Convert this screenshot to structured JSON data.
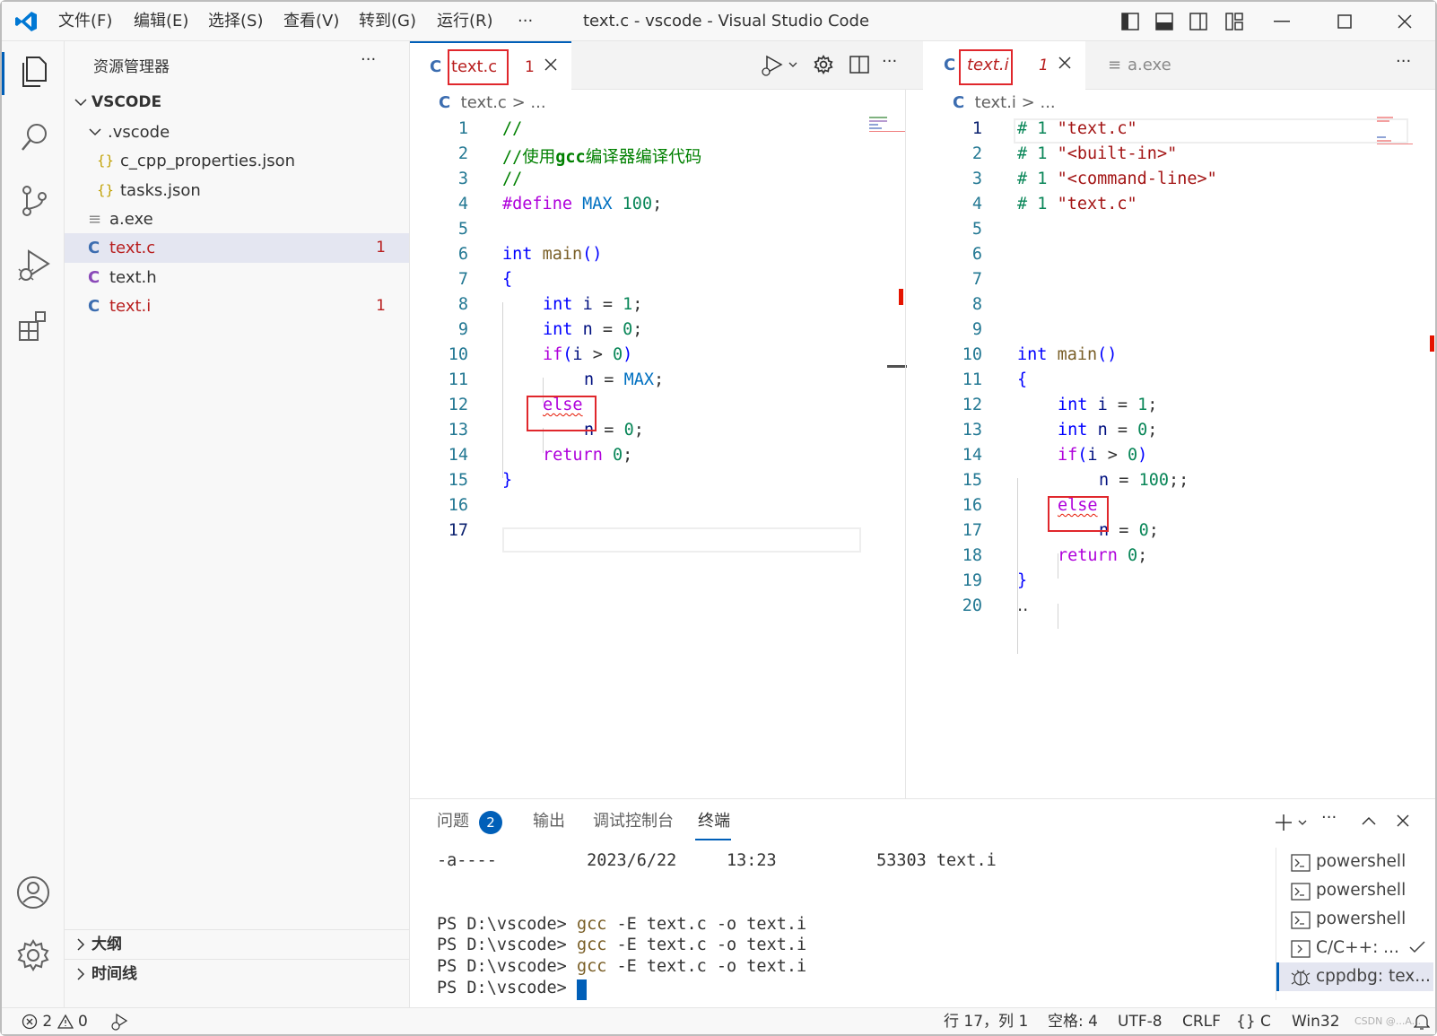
{
  "window": {
    "title": "text.c - vscode - Visual Studio Code"
  },
  "menu": [
    "文件(F)",
    "编辑(E)",
    "选择(S)",
    "查看(V)",
    "转到(G)",
    "运行(R)",
    "···"
  ],
  "sidebar": {
    "title": "资源管理器",
    "more": "···",
    "root": "VSCODE",
    "folder": ".vscode",
    "items": [
      {
        "label": "c_cpp_properties.json",
        "icon": "{}"
      },
      {
        "label": "tasks.json",
        "icon": "{}"
      },
      {
        "label": "a.exe",
        "icon": "≡"
      },
      {
        "label": "text.c",
        "icon": "C",
        "badge": "1"
      },
      {
        "label": "text.h",
        "icon": "C"
      },
      {
        "label": "text.i",
        "icon": "C",
        "badge": "1"
      }
    ],
    "outline": "大纲",
    "timeline": "时间线"
  },
  "editor1": {
    "tab": {
      "icon": "C",
      "label": "text.c",
      "badge": "1"
    },
    "breadcrumb": {
      "icon": "C",
      "file": "text.c",
      "sep": ">",
      "rest": "..."
    },
    "lines": [
      "1",
      "2",
      "3",
      "4",
      "5",
      "6",
      "7",
      "8",
      "9",
      "10",
      "11",
      "12",
      "13",
      "14",
      "15",
      "16",
      "17"
    ],
    "code": {
      "l1": "//",
      "l2a": "//使用",
      "l2b": "gcc",
      "l2c": "编译器编译代码",
      "l3": "//",
      "l4a": "#define",
      "l4b": "MAX",
      "l4c": "100",
      "l4d": ";",
      "int": "int",
      "main": "main",
      "paren": "()",
      "obrace": "{",
      "cbrace": "}",
      "i": "i",
      "n": "n",
      "eq": " = ",
      "one": "1",
      "zero": "0",
      "semi": ";",
      "if": "if",
      "gt": " > ",
      "max": "MAX",
      "else": "else",
      "return": "return"
    }
  },
  "editor2": {
    "tab": {
      "icon": "C",
      "label": "text.i",
      "badge": "1"
    },
    "tab2": {
      "icon": "≡",
      "label": "a.exe"
    },
    "breadcrumb": {
      "icon": "C",
      "file": "text.i",
      "sep": ">",
      "rest": "..."
    },
    "lines": [
      "1",
      "2",
      "3",
      "4",
      "5",
      "6",
      "7",
      "8",
      "9",
      "10",
      "11",
      "12",
      "13",
      "14",
      "15",
      "16",
      "17",
      "18",
      "19",
      "20"
    ],
    "code": {
      "hash": "# 1",
      "f1": "\"text.c\"",
      "f2": "\"<built-in>\"",
      "f3": "\"<command-line>\"",
      "f4": "\"text.c\"",
      "hundred": "100",
      "dsemi": ";;",
      "dots": "‥"
    }
  },
  "panel": {
    "tabs": [
      "问题",
      "输出",
      "调试控制台",
      "终端"
    ],
    "problems_count": "2",
    "terminal_lines": [
      "-a----         2023/6/22     13:23          53303 text.i",
      "",
      "",
      "PS D:\\vscode> ",
      "PS D:\\vscode> ",
      "PS D:\\vscode> ",
      "PS D:\\vscode> "
    ],
    "cmd_gcc": "gcc",
    "cmd_rest": " -E text.c -o text.i",
    "terminals": [
      "powershell",
      "powershell",
      "powershell",
      "C/C++: ...",
      "cppdbg: tex..."
    ]
  },
  "status": {
    "errors": "2",
    "warnings": "0",
    "position": "行 17，列 1",
    "spaces": "空格: 4",
    "encoding": "UTF-8",
    "eol": "CRLF",
    "lang": "{} C",
    "platform": "Win32",
    "watermark": "CSDN @...A..."
  },
  "colors": {
    "accent": "#005fb8",
    "error": "#e51400",
    "highlight": "#e4e6f1"
  }
}
